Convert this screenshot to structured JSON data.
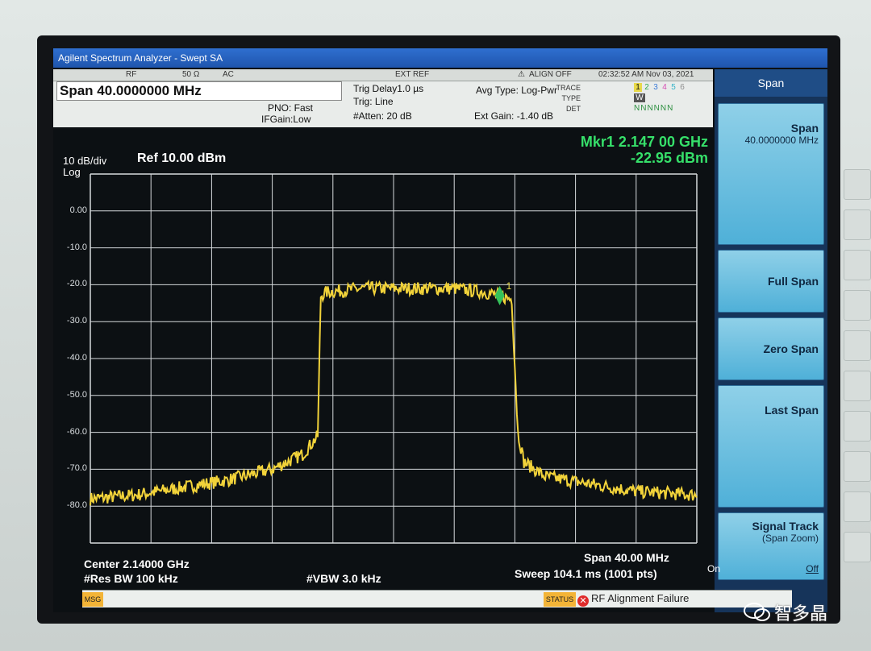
{
  "window": {
    "title": "Agilent Spectrum Analyzer - Swept SA"
  },
  "header": {
    "row1": {
      "item_rf": "RF",
      "item_ohm": "50 Ω",
      "item_ac": "AC",
      "ext_ref": "EXT REF",
      "align": "ALIGN OFF",
      "datetime": "02:32:52 AM Nov 03, 2021"
    },
    "span": "Span 40.0000000 MHz",
    "pno": "PNO: Fast",
    "ifgain": "IFGain:Low",
    "trig_delay": "Trig Delay1.0 µs",
    "trig": "Trig: Line",
    "atten": "#Atten: 20 dB",
    "avg_type": "Avg Type: Log-Pwr",
    "ext_gain": "Ext Gain: -1.40 dB",
    "trace_label": "TRACE",
    "type_label": "TYPE",
    "det_label": "DET",
    "trace_nums": [
      "1",
      "2",
      "3",
      "4",
      "5",
      "6"
    ],
    "type_vals": "W",
    "det_vals": "NNNNNN"
  },
  "marker": {
    "label": "Mkr1 2.147 00 GHz",
    "value": "-22.95 dBm",
    "id": "1"
  },
  "scale": {
    "div": "10 dB/div",
    "mode": "Log",
    "ref": "Ref 10.00 dBm"
  },
  "footer": {
    "center": "Center 2.14000 GHz",
    "res_bw": "#Res BW 100 kHz",
    "vbw": "#VBW 3.0 kHz",
    "span": "Span 40.00 MHz",
    "sweep": "Sweep  104.1 ms (1001 pts)"
  },
  "softkeys": {
    "title": "Span",
    "span": {
      "label": "Span",
      "value": "40.0000000 MHz"
    },
    "full_span": "Full Span",
    "zero_span": "Zero Span",
    "last_span": "Last Span",
    "signal_track": "Signal Track",
    "signal_track_sub": "(Span Zoom)",
    "on": "On",
    "off": "Off"
  },
  "status": {
    "msg": "MSG",
    "status": "STATUS",
    "message": "RF Alignment Failure"
  },
  "watermark": "智多晶",
  "chart_data": {
    "type": "line",
    "yticks": [
      "0.00",
      "-10.0",
      "-20.0",
      "-30.0",
      "-40.0",
      "-50.0",
      "-60.0",
      "-70.0",
      "-80.0"
    ],
    "ylim": [
      -90,
      10
    ],
    "xlim_mhz": [
      2120,
      2160
    ],
    "series": [
      {
        "x_mhz": [
          2120,
          2123,
          2126,
          2129,
          2132,
          2134,
          2135,
          2135.2,
          2135.6,
          2138,
          2140,
          2142,
          2144,
          2146,
          2147,
          2147.8,
          2148.2,
          2148.6,
          2150,
          2153,
          2156,
          2160
        ],
        "y_dbm": [
          -78,
          -77,
          -75,
          -73,
          -70,
          -66,
          -61,
          -23,
          -22,
          -21,
          -21,
          -21,
          -21,
          -22,
          -23,
          -24,
          -60,
          -68,
          -72,
          -74,
          -76,
          -77
        ]
      }
    ],
    "colors": {
      "trace": "#f2d33a",
      "grid": "#d6dadd",
      "marker": "#35c25b"
    }
  }
}
